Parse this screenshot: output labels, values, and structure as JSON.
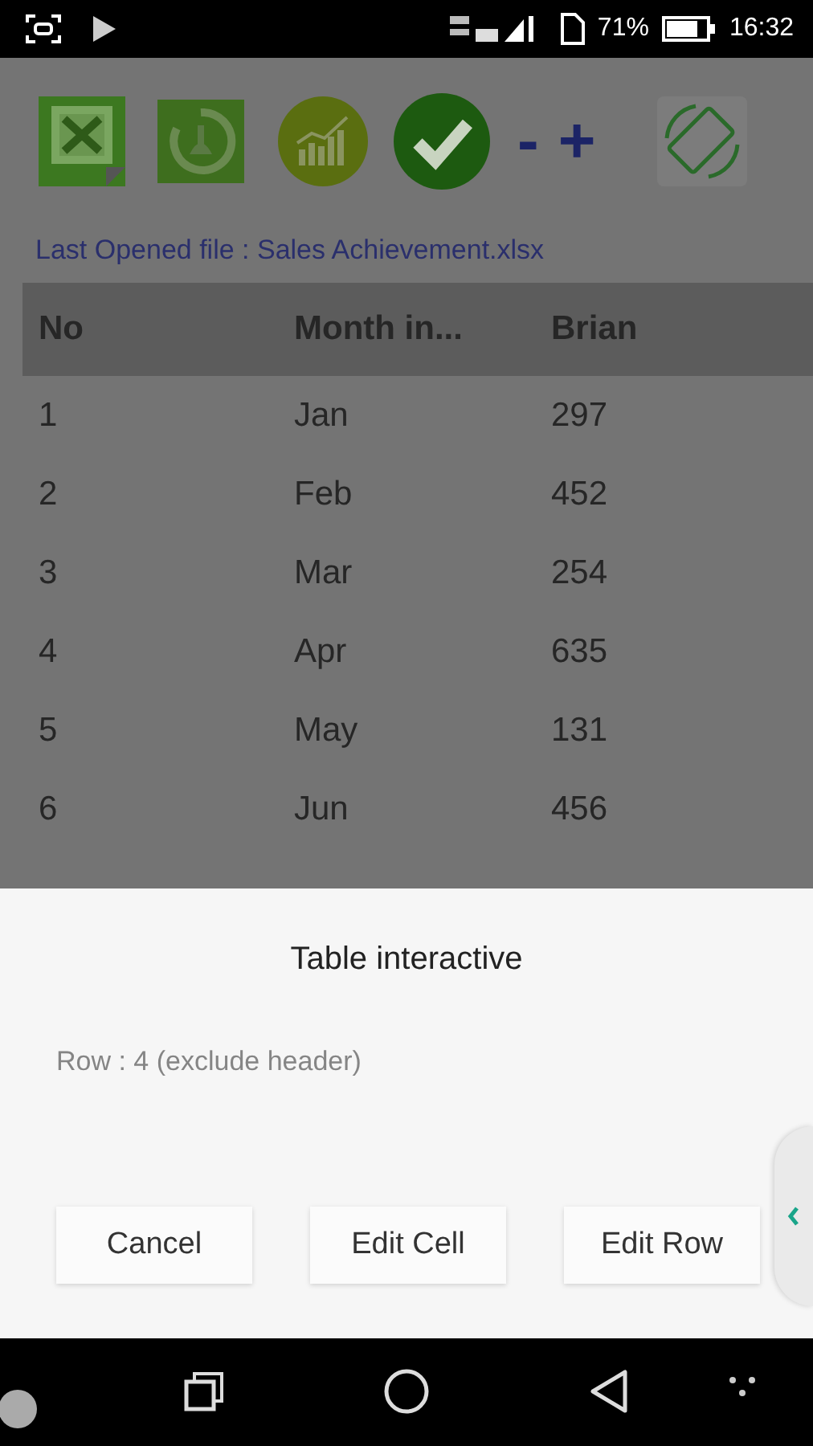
{
  "status_bar": {
    "battery": "71%",
    "time": "16:32"
  },
  "toolbar": {
    "zoom_out": "-",
    "zoom_in": "+"
  },
  "last_opened": "Last Opened file : Sales Achievement.xlsx",
  "table": {
    "columns": [
      "No",
      "Month in...",
      "Brian"
    ],
    "rows": [
      [
        "1",
        "Jan",
        "297"
      ],
      [
        "2",
        "Feb",
        "452"
      ],
      [
        "3",
        "Mar",
        "254"
      ],
      [
        "4",
        "Apr",
        "635"
      ],
      [
        "5",
        "May",
        "131"
      ],
      [
        "6",
        "Jun",
        "456"
      ]
    ]
  },
  "dialog": {
    "title": "Table interactive",
    "message": "Row : 4 (exclude header)",
    "buttons": [
      "Cancel",
      "Edit Cell",
      "Edit Row"
    ]
  }
}
